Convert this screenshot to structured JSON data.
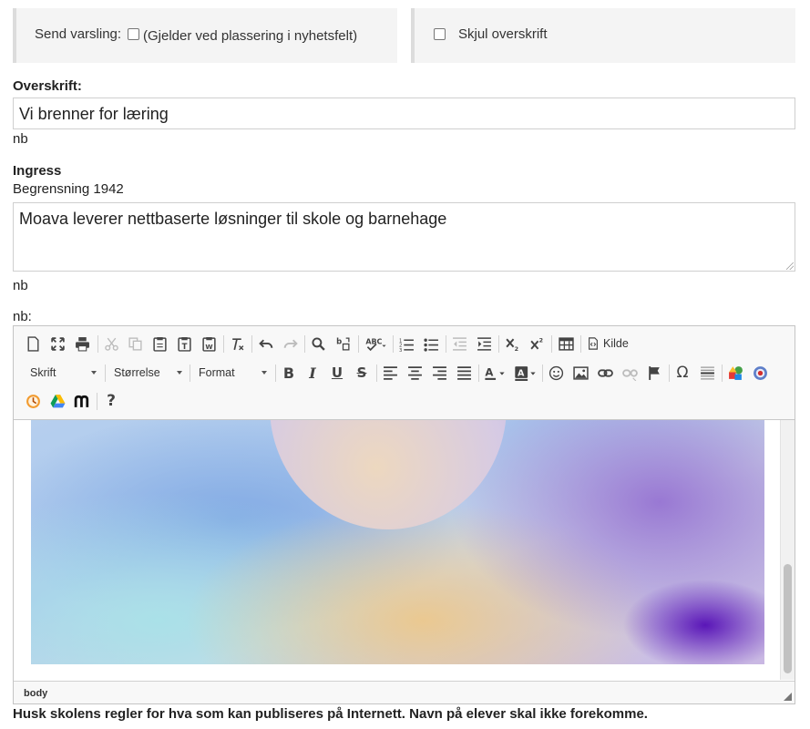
{
  "notify": {
    "label": "Send varsling:",
    "checkbox_text": "(Gjelder ved plassering i nyhetsfelt)",
    "checked": false
  },
  "hide_heading": {
    "label": "Skjul overskrift",
    "checked": false
  },
  "heading": {
    "label": "Overskrift:",
    "value": "Vi brenner for læring",
    "lang": "nb"
  },
  "ingress": {
    "label": "Ingress",
    "limit_text": "Begrensning 1942",
    "value": "Moava leverer nettbaserte løsninger til skole og barnehage",
    "lang": "nb"
  },
  "editor": {
    "lang_label": "nb:",
    "toolbar": {
      "source_label": "Kilde",
      "font_combo": "Skrift",
      "size_combo": "Størrelse",
      "format_combo": "Format"
    },
    "element_path": "body"
  },
  "notice": "Husk skolens regler for hva som kan publiseres på Internett. Navn på elever skal ikke forekomme."
}
